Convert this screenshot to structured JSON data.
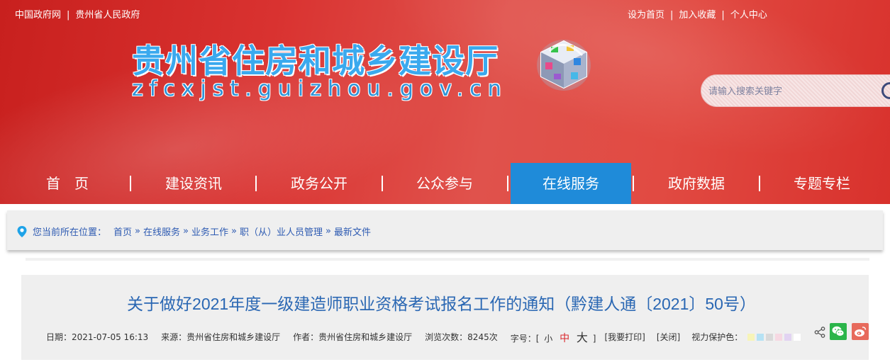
{
  "topbar": {
    "left": [
      "中国政府网",
      "贵州省人民政府"
    ],
    "right": [
      "设为首页",
      "加入收藏",
      "个人中心"
    ]
  },
  "logo": {
    "title": "贵州省住房和城乡建设厅",
    "subtitle": "zfcxjst.guizhou.gov.cn"
  },
  "search": {
    "placeholder": "请输入搜索关键字"
  },
  "nav": {
    "items": [
      {
        "label": "首　页"
      },
      {
        "label": "建设资讯"
      },
      {
        "label": "政务公开"
      },
      {
        "label": "公众参与"
      },
      {
        "label": "在线服务"
      },
      {
        "label": "政府数据"
      },
      {
        "label": "专题专栏"
      }
    ],
    "active": "在线服务"
  },
  "breadcrumb": {
    "label": "您当前所在位置：",
    "items": [
      "首页",
      "在线服务",
      "业务工作",
      "职（从）业人员管理",
      "最新文件"
    ],
    "arrow": "»"
  },
  "article": {
    "title": "关于做好2021年度一级建造师职业资格考试报名工作的通知（黔建人通〔2021〕50号）",
    "date": "日期：2021-07-05 16:13",
    "source": "来源：贵州省住房和城乡建设厅",
    "author": "作者：贵州省住房和城乡建设厅",
    "views": "浏览次数：8245次",
    "font_size_label": "字号：[",
    "font_small": "小",
    "font_mid": "中",
    "font_big": "大",
    "font_close": "]",
    "print": "[我要打印]",
    "close": "[关闭]",
    "eye_color_label": "视力保护色："
  },
  "eye_colors": [
    "#f7f4b8",
    "#b6e2f4",
    "#d9d9d9",
    "#f6d8e2",
    "#e2d3f2",
    "#ffffff"
  ],
  "colors": {
    "header_red": "#d93230",
    "nav_active": "#1f8bd9",
    "link_blue": "#2e5bb2",
    "title_blue": "#2a67b3",
    "wechat_green": "#2bb54a",
    "weibo_red": "#e76a5c"
  }
}
